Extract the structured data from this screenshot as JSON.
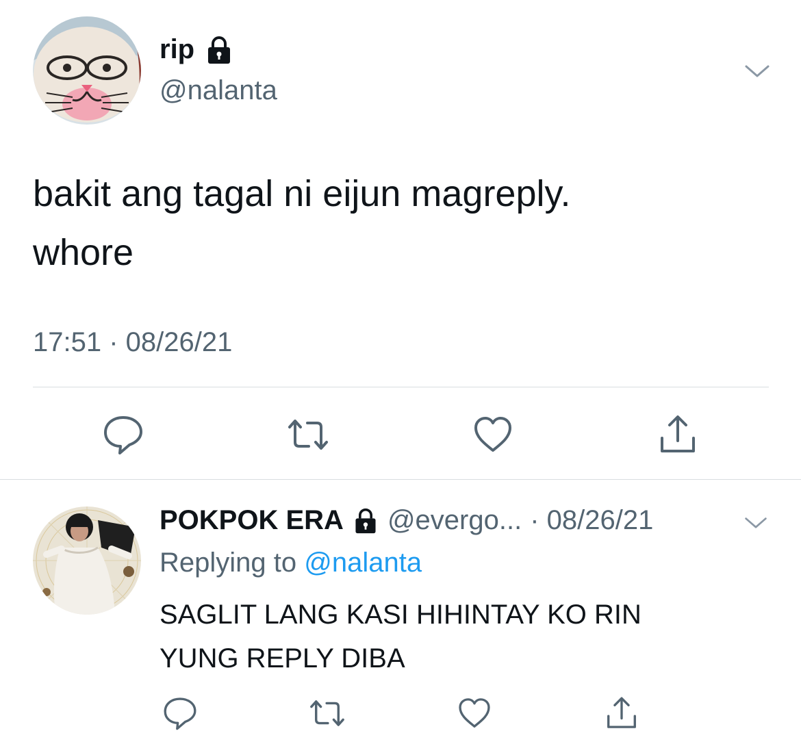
{
  "main_tweet": {
    "display_name": "rip",
    "handle": "@nalanta",
    "text_lines": [
      "bakit ang tagal ni eijun magreply.",
      "whore"
    ],
    "timestamp": "17:51 · 08/26/21",
    "actions": [
      "reply-icon",
      "retweet-icon",
      "like-icon",
      "share-icon"
    ]
  },
  "reply": {
    "display_name": "POKPOK ERA",
    "handle": "@evergo...",
    "date": "· 08/26/21",
    "replying_to_prefix": "Replying to ",
    "replying_to_handle": "@nalanta",
    "text_lines": [
      "SAGLIT LANG KASI HIHINTAY KO RIN",
      "YUNG REPLY DIBA"
    ],
    "actions": [
      "reply-icon",
      "retweet-icon",
      "like-icon",
      "share-icon"
    ]
  },
  "colors": {
    "text_primary": "#0f1419",
    "text_secondary": "#536471",
    "link": "#1d9bf0",
    "divider": "#d9dde0"
  }
}
